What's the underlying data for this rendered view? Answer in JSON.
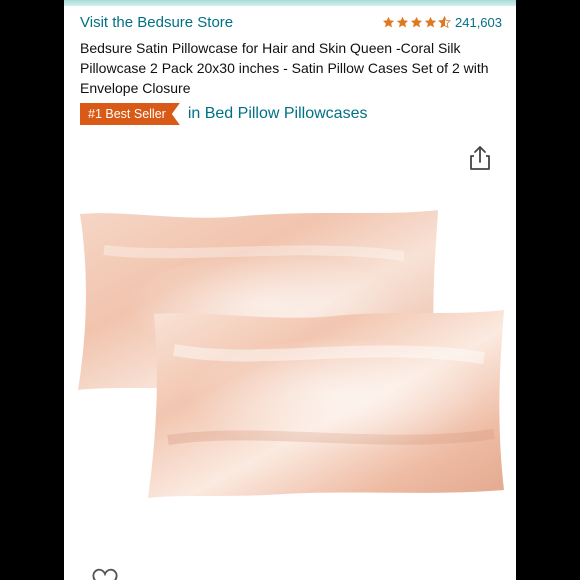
{
  "store": {
    "link_label": "Visit the Bedsure Store"
  },
  "rating": {
    "stars": 4.5,
    "count": "241,603"
  },
  "product": {
    "title": "Bedsure Satin Pillowcase for Hair and Skin Queen -Coral Silk Pillowcase 2 Pack 20x30 inches - Satin Pillow Cases Set of 2 with Envelope Closure"
  },
  "badge": {
    "label": "#1 Best Seller",
    "category": "in Bed Pillow Pillowcases"
  },
  "icons": {
    "share": "share-icon",
    "favorite": "heart-icon",
    "star": "star-icon"
  },
  "colors": {
    "link": "#007185",
    "star": "#de7921",
    "badge": "#d85a16",
    "satin": "#f3c9b6"
  }
}
